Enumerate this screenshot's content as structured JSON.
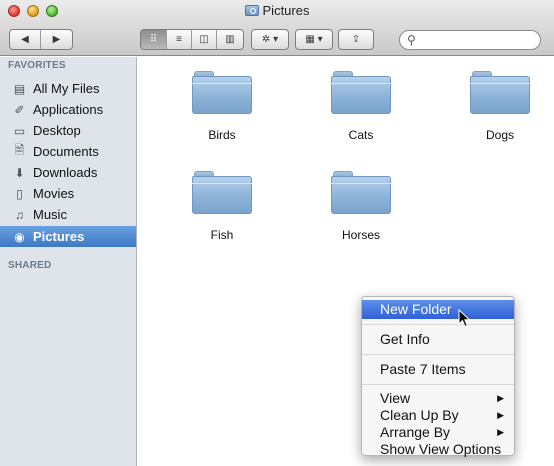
{
  "window": {
    "title": "Pictures",
    "title_icon": "pictures-folder-icon"
  },
  "toolbar": {
    "back_icon": "chevron-left-icon",
    "forward_icon": "chevron-right-icon",
    "views": [
      {
        "name": "icon-view",
        "glyph": "⠿"
      },
      {
        "name": "list-view",
        "glyph": "≡"
      },
      {
        "name": "column-view",
        "glyph": "◫"
      },
      {
        "name": "cover-flow-view",
        "glyph": "▥"
      }
    ],
    "action_glyph": "✲ ▾",
    "arrange_glyph": "▦ ▾",
    "share_glyph": "⇪",
    "search": {
      "placeholder": "",
      "value": ""
    }
  },
  "sidebar": {
    "favorites_heading": "FAVORITES",
    "shared_heading": "SHARED",
    "items": [
      {
        "label": "All My Files",
        "icon": "all-files-icon",
        "glyph": "▤"
      },
      {
        "label": "Applications",
        "icon": "applications-icon",
        "glyph": "✐"
      },
      {
        "label": "Desktop",
        "icon": "desktop-icon",
        "glyph": "▭"
      },
      {
        "label": "Documents",
        "icon": "documents-icon",
        "glyph": "🗎"
      },
      {
        "label": "Downloads",
        "icon": "downloads-icon",
        "glyph": "⬇"
      },
      {
        "label": "Movies",
        "icon": "movies-icon",
        "glyph": "▯"
      },
      {
        "label": "Music",
        "icon": "music-icon",
        "glyph": "♫"
      },
      {
        "label": "Pictures",
        "icon": "pictures-icon",
        "glyph": "◉"
      }
    ],
    "selected": "Pictures"
  },
  "folders": [
    {
      "label": "Birds"
    },
    {
      "label": "Cats"
    },
    {
      "label": "Dogs"
    },
    {
      "label": "Fish"
    },
    {
      "label": "Horses"
    }
  ],
  "context_menu": {
    "items": [
      {
        "label": "New Folder",
        "highlighted": true
      },
      {
        "label": "Get Info"
      },
      {
        "label": "Paste 7 Items"
      },
      {
        "label": "View",
        "submenu": true
      },
      {
        "label": "Clean Up By",
        "submenu": true
      },
      {
        "label": "Arrange By",
        "submenu": true
      },
      {
        "label": "Show View Options"
      }
    ],
    "submenu_glyph": "▶"
  },
  "colors": {
    "selection": "#3e78c6",
    "menu_highlight": "#2f60d8",
    "folder": "#8db3d8"
  }
}
